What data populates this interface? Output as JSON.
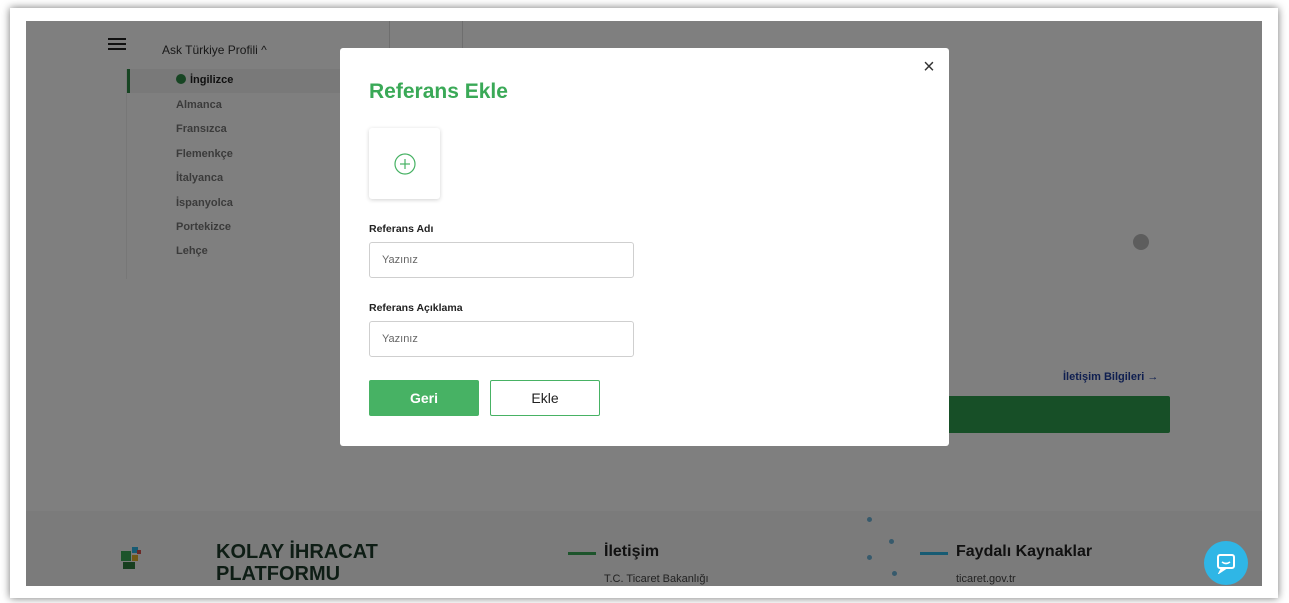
{
  "background": {
    "profile_title": "Ask Türkiye Profili ^",
    "languages": [
      {
        "label": "İngilizce",
        "active": true
      },
      {
        "label": "Almanca"
      },
      {
        "label": "Fransızca"
      },
      {
        "label": "Flemenkçe"
      },
      {
        "label": "İtalyanca"
      },
      {
        "label": "İspanyolca"
      },
      {
        "label": "Portekizce"
      },
      {
        "label": "Lehçe"
      }
    ],
    "contact_link": "İletişim Bilgileri →"
  },
  "footer": {
    "brand_line1": "KOLAY İHRACAT",
    "brand_line2": "PLATFORMU",
    "col1_title": "İletişim",
    "col1_sub": "T.C. Ticaret Bakanlığı",
    "col2_title": "Faydalı Kaynaklar",
    "col2_sub": "ticaret.gov.tr"
  },
  "modal": {
    "title": "Referans Ekle",
    "close_symbol": "×",
    "field1_label": "Referans Adı",
    "field1_placeholder": "Yazınız",
    "field1_value": "",
    "field2_label": "Referans Açıklama",
    "field2_placeholder": "Yazınız",
    "field2_value": "",
    "back_label": "Geri",
    "add_label": "Ekle"
  },
  "colors": {
    "accent_green": "#3aa957",
    "primary_button": "#47b264",
    "link_blue": "#1f3fa0",
    "chat_button": "#2fb6e6"
  }
}
